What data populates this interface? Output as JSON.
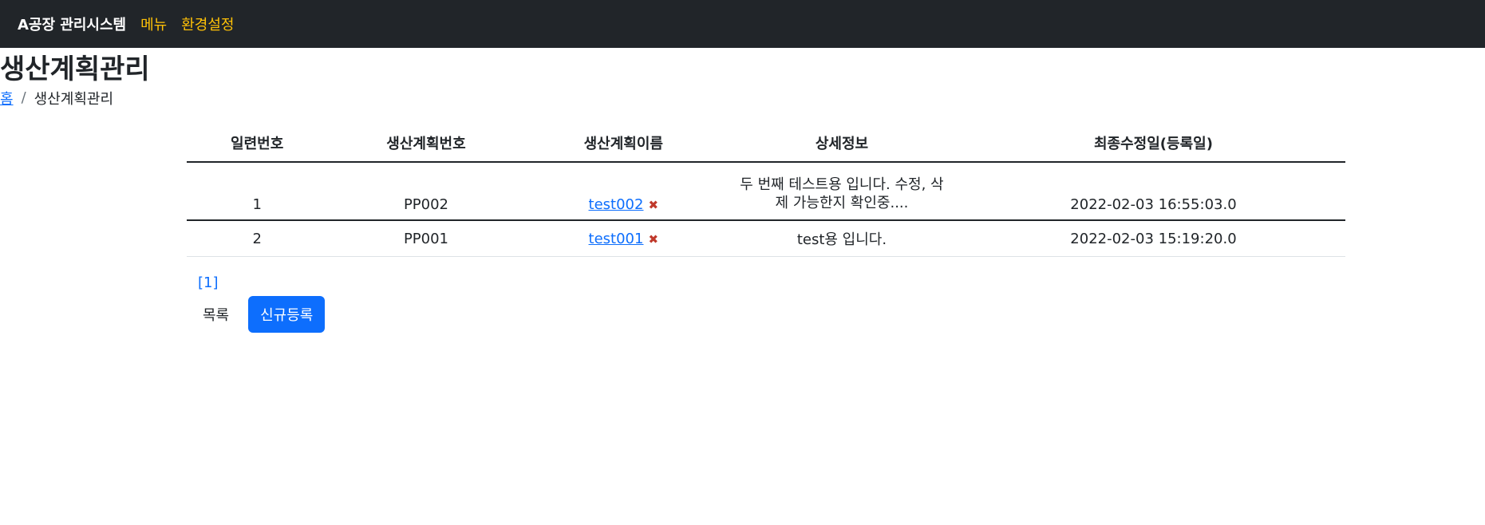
{
  "nav": {
    "brand": "A공장 관리시스템",
    "links": [
      "메뉴",
      "환경설정"
    ]
  },
  "page": {
    "title": "생산계획관리",
    "breadcrumb": {
      "home": "홈",
      "separator": "/",
      "current": "생산계획관리"
    }
  },
  "table": {
    "headers": [
      "일련번호",
      "생산계획번호",
      "생산계획이름",
      "상세정보",
      "최종수정일(등록일)"
    ],
    "rows": [
      {
        "no": "1",
        "plan_no": "PP002",
        "plan_name": "test002",
        "detail": "두 번째 테스트용 입니다. 수정, 삭제 가능한지 확인중....",
        "updated": "2022-02-03 16:55:03.0"
      },
      {
        "no": "2",
        "plan_no": "PP001",
        "plan_name": "test001",
        "detail": "test용 입니다.",
        "updated": "2022-02-03 15:19:20.0"
      }
    ]
  },
  "pagination": {
    "page": "[1]"
  },
  "buttons": {
    "list": "목록",
    "new": "신규등록"
  },
  "icons": {
    "delete": "delete-x-icon"
  },
  "colors": {
    "navbar_bg": "#212529",
    "nav_link": "#ffc107",
    "primary": "#0d6efd",
    "delete_icon": "#c0392b"
  }
}
